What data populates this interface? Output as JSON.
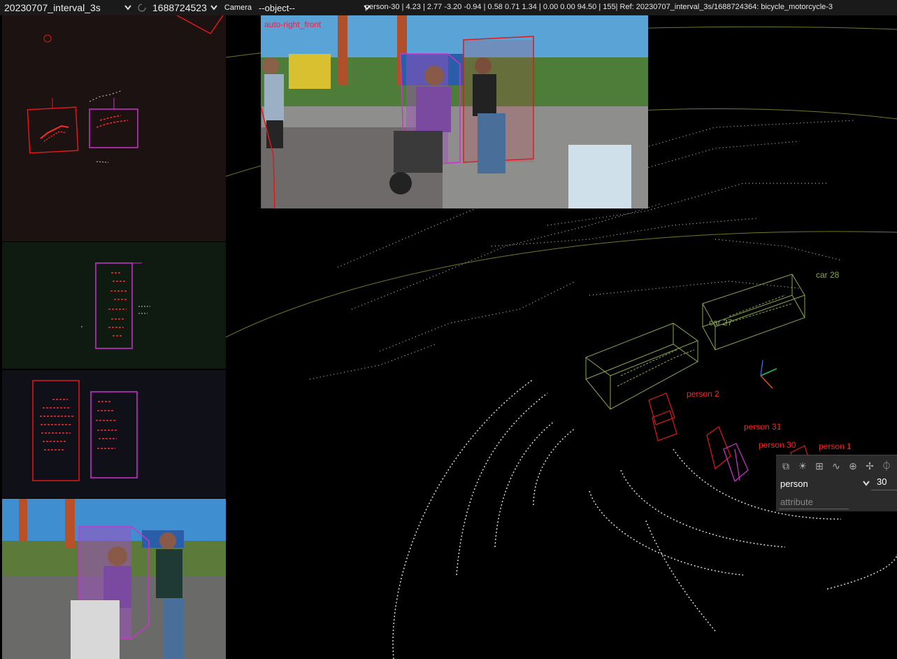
{
  "toolbar": {
    "scene": "20230707_interval_3s",
    "frame": "1688724523",
    "camera_label": "Camera",
    "object_select": "--object--",
    "info": "person-30 | 4.23 | 2.77 -3.20 -0.94 | 0.58 0.71 1.34 | 0.00 0.00 94.50 | 155| Ref: 20230707_interval_3s/1688724364: bicycle_motorcycle-3"
  },
  "camera_overlay": {
    "name": "auto-right_front"
  },
  "labels": [
    {
      "text": "car 28",
      "color": "#8aa84a"
    },
    {
      "text": "car 27",
      "color": "#8aa84a"
    },
    {
      "text": "person 2",
      "color": "#ff2020"
    },
    {
      "text": "person 31",
      "color": "#ff2020"
    },
    {
      "text": "person 30",
      "color": "#ff2020"
    },
    {
      "text": "person 1",
      "color": "#ff2020"
    }
  ],
  "object_panel": {
    "class_value": "person",
    "track_id": "30",
    "attribute_placeholder": "attribute",
    "tools": [
      "copy-icon",
      "light-icon",
      "layout-icon",
      "curve-icon",
      "zoom-icon",
      "move-icon",
      "pin-icon"
    ]
  },
  "colors": {
    "person": "#ff2020",
    "selected": "#d030d0",
    "car": "#8aa84a",
    "points": "#cfcfcf"
  }
}
